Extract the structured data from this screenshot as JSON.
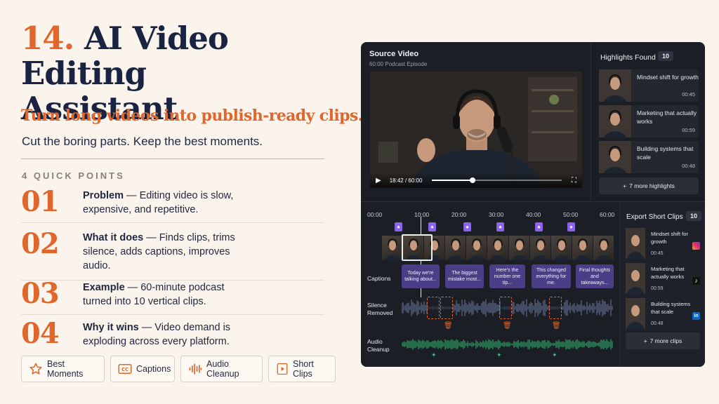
{
  "title": {
    "number": "14.",
    "line1": "AI Video Editing",
    "line2": "Assistant"
  },
  "subtitle": "Turn long videos into publish-ready clips.",
  "tagline": "Cut the boring parts. Keep the best moments.",
  "quick_points_heading": "4 QUICK POINTS",
  "points": [
    {
      "num": "01",
      "bold": "Problem",
      "text": " — Editing video is slow, expensive, and repetitive."
    },
    {
      "num": "02",
      "bold": "What it does",
      "text": " — Finds clips, trims silence, adds captions, improves audio."
    },
    {
      "num": "03",
      "bold": "Example",
      "text": " — 60-minute podcast turned into 10 vertical clips."
    },
    {
      "num": "04",
      "bold": "Why it wins",
      "text": " — Video demand is exploding across every platform."
    }
  ],
  "chips": [
    {
      "label": "Best Moments",
      "icon": "star-icon"
    },
    {
      "label": "Captions",
      "icon": "cc-icon"
    },
    {
      "label": "Audio Cleanup",
      "icon": "waveform-icon"
    },
    {
      "label": "Short Clips",
      "icon": "play-square-icon"
    }
  ],
  "colors": {
    "accent": "#e0662b",
    "navy": "#1a2442",
    "panel": "#1b1e25",
    "caption": "#4b3d86",
    "marker": "#8a63e8",
    "audio": "#34c27b"
  },
  "source_video": {
    "title": "Source Video",
    "subtitle": "60:00 Podcast Episode",
    "time": "18:42 / 60:00",
    "progress": 0.31
  },
  "highlights": {
    "title": "Highlights Found",
    "count": "10",
    "items": [
      {
        "label": "Mindset shift for growth",
        "duration": "00:45"
      },
      {
        "label": "Marketing that actually works",
        "duration": "00:59"
      },
      {
        "label": "Building systems that scale",
        "duration": "00:48"
      }
    ],
    "more": "7 more highlights"
  },
  "timeline": {
    "ticks": [
      "00:00",
      "10:00",
      "20:00",
      "30:00",
      "40:00",
      "50:00",
      "60:00"
    ],
    "captions_label": "Captions",
    "silence_label": "Silence Removed",
    "audio_label": "Audio Cleanup",
    "captions": [
      "Today we're talking about...",
      "The biggest mistake most...",
      "Here's the number one tip...",
      "This changed everything for me.",
      "Final thoughts and takeaways..."
    ]
  },
  "export": {
    "title": "Export Short Clips",
    "count": "10",
    "items": [
      {
        "label": "Mindset shift for growth",
        "duration": "00:45",
        "platform": "instagram-icon"
      },
      {
        "label": "Marketing that actually works",
        "duration": "00:59",
        "platform": "tiktok-icon"
      },
      {
        "label": "Building systems that scale",
        "duration": "00:48",
        "platform": "linkedin-icon"
      }
    ],
    "more": "7 more clips"
  }
}
